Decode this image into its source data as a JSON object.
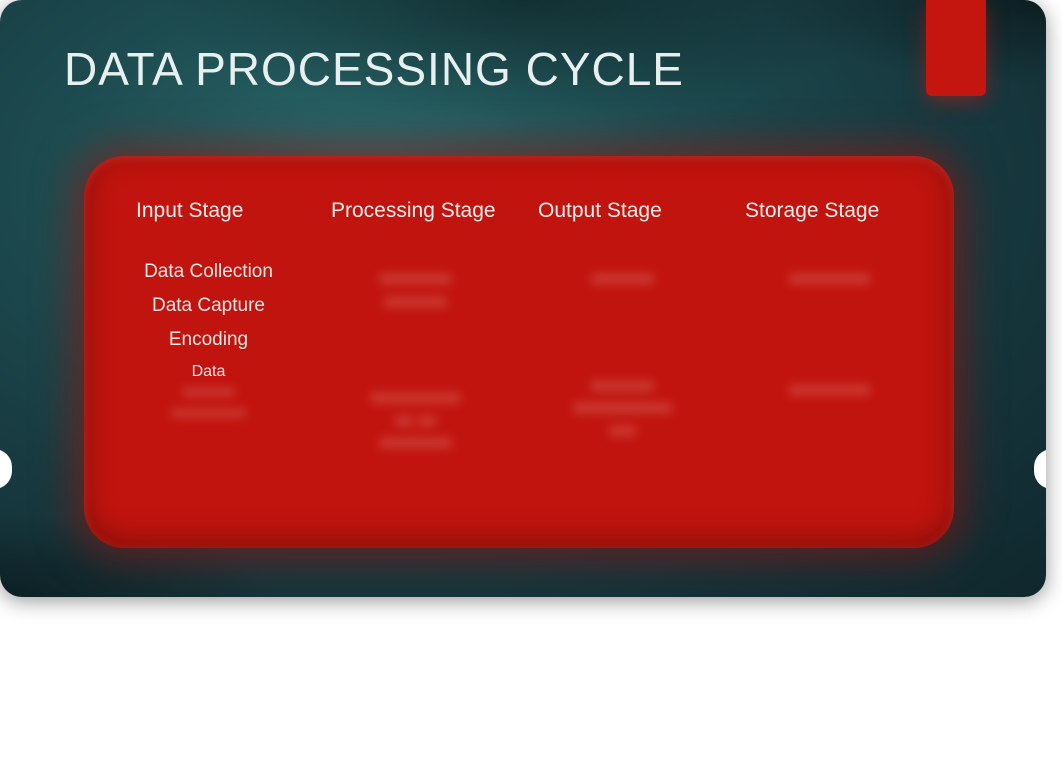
{
  "title": "DATA PROCESSING CYCLE",
  "columns": [
    {
      "header": "Input Stage",
      "clear_items": [
        "Data Collection",
        "Data Capture",
        "Encoding",
        "Data"
      ]
    },
    {
      "header": "Processing Stage"
    },
    {
      "header": "Output Stage"
    },
    {
      "header": "Storage Stage"
    }
  ]
}
